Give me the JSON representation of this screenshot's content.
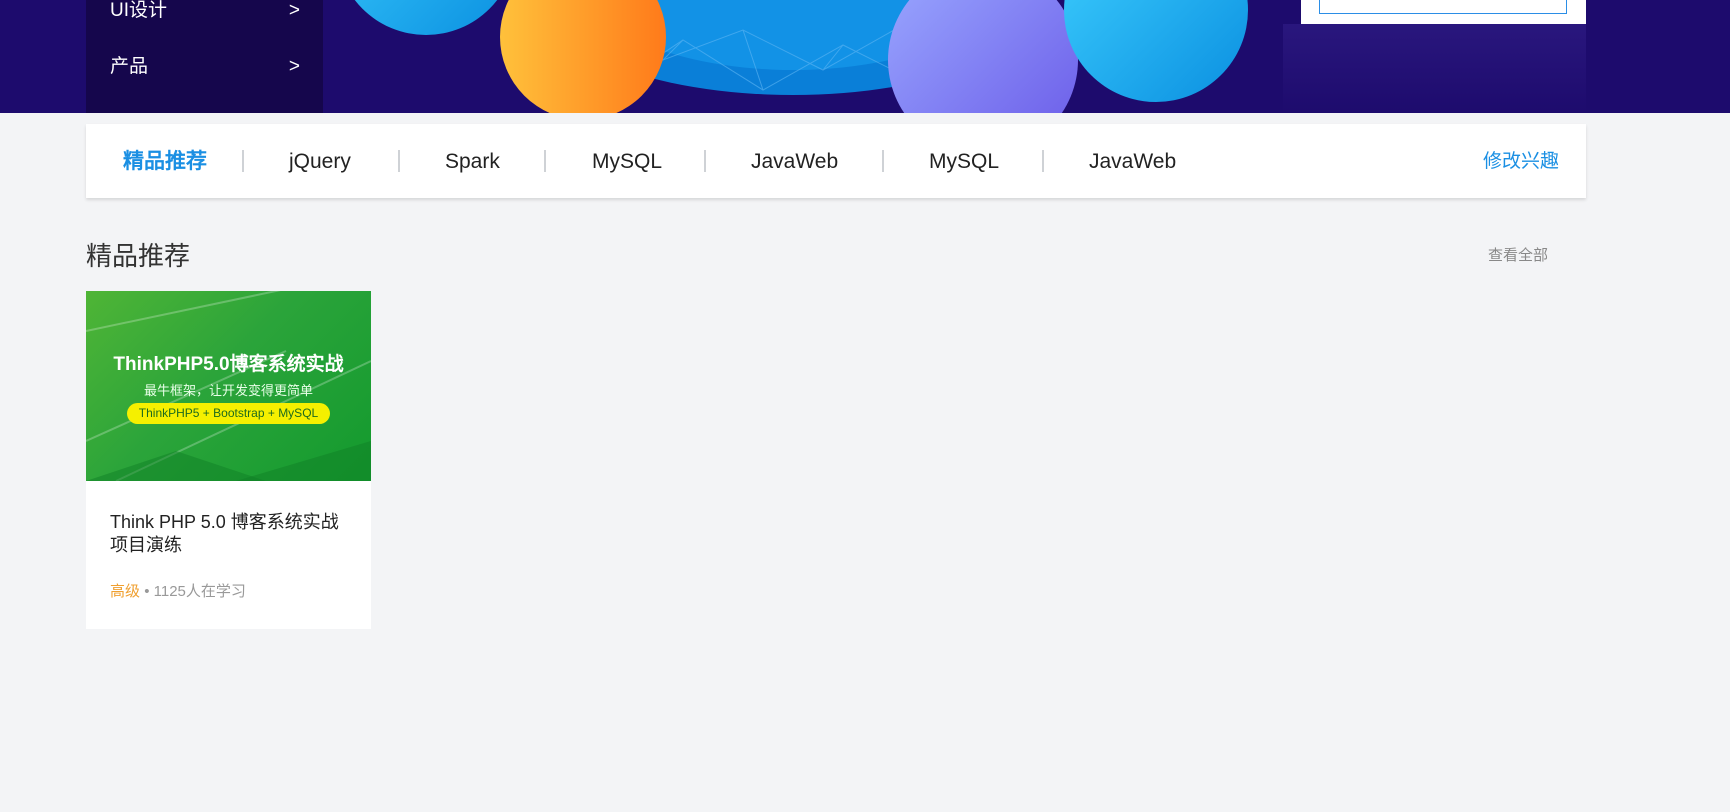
{
  "side_menu": {
    "items": [
      {
        "label": "UI设计",
        "arrow": ">"
      },
      {
        "label": "产品",
        "arrow": ">"
      }
    ]
  },
  "tabs": {
    "items": [
      {
        "label": "精品推荐",
        "active": true
      },
      {
        "label": "jQuery",
        "active": false
      },
      {
        "label": "Spark",
        "active": false
      },
      {
        "label": "MySQL",
        "active": false
      },
      {
        "label": "JavaWeb",
        "active": false
      },
      {
        "label": "MySQL",
        "active": false
      },
      {
        "label": "JavaWeb",
        "active": false
      }
    ],
    "edit_label": "修改兴趣"
  },
  "section": {
    "title": "精品推荐",
    "view_all": "查看全部"
  },
  "course": {
    "image_title": "ThinkPHP5.0博客系统实战",
    "image_subtitle": "最牛框架，让开发变得更简单",
    "image_pill": "ThinkPHP5 + Bootstrap + MySQL",
    "title": "Think PHP 5.0 博客系统实战项目演练",
    "level": "高级",
    "dot": "•",
    "learners": "1125人在学习"
  },
  "colors": {
    "accent": "#1a8fe3",
    "level": "#f0a030",
    "banner_bg": "#1d0b6d"
  }
}
